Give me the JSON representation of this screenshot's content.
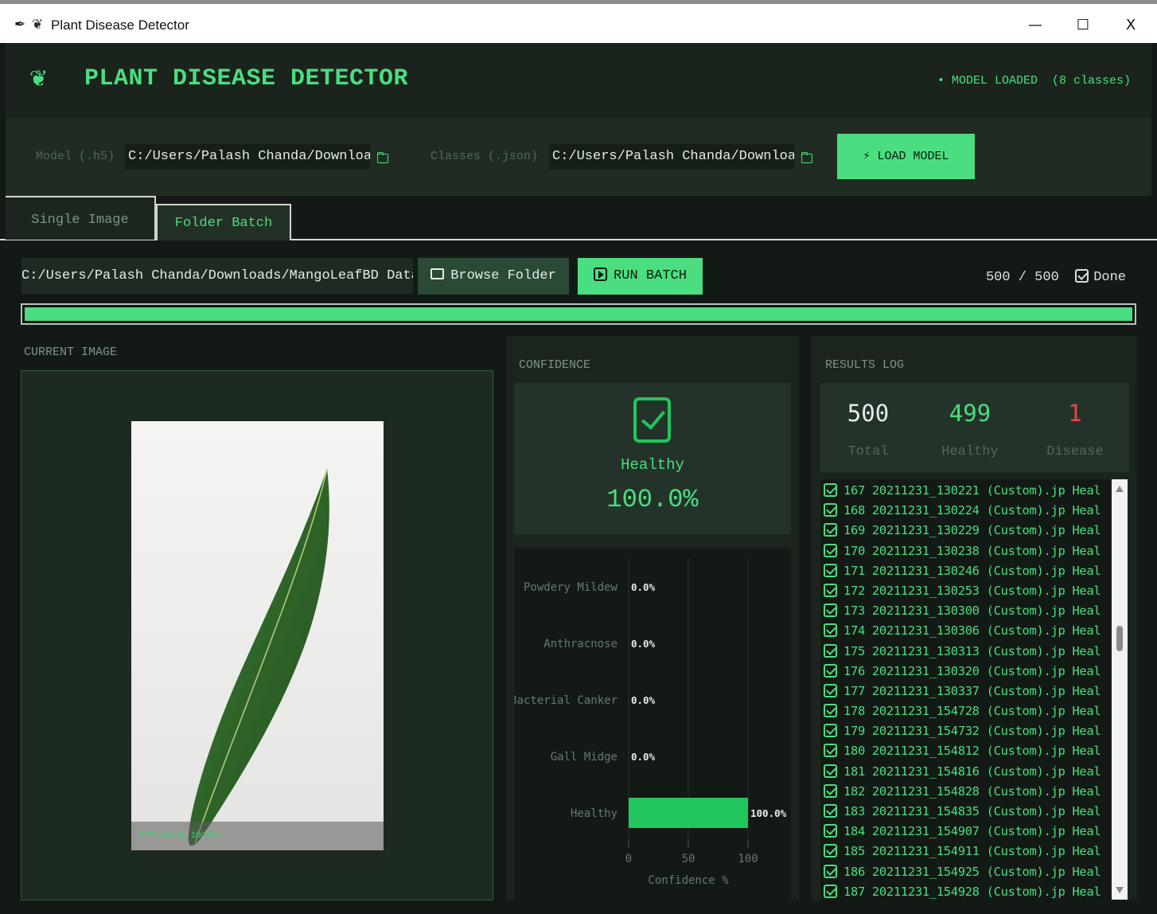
{
  "window": {
    "title": "Plant Disease Detector",
    "feather_icon": "feather-icon",
    "app_icon": "leaf-icon",
    "min_glyph": "—",
    "max_glyph": "☐",
    "close_glyph": "X"
  },
  "header": {
    "logo": "leaf-logo-icon",
    "title": "PLANT DISEASE DETECTOR",
    "status": "• MODEL LOADED  (8 classes)"
  },
  "model": {
    "model_label": "Model (.h5)",
    "model_path": "C:/Users/Palash Chanda/Downloads,",
    "classes_label": "Classes (.json)",
    "classes_path": "C:/Users/Palash Chanda/Downloads,",
    "load_button": "⚡ LOAD MODEL"
  },
  "tabs": [
    {
      "label": "Single Image",
      "active": false
    },
    {
      "label": "Folder Batch",
      "active": true
    }
  ],
  "batch": {
    "folder_path": "C:/Users/Palash Chanda/Downloads/MangoLeafBD Dataset,",
    "browse_label": "Browse Folder",
    "run_label": "RUN BATCH",
    "progress_count": "500 / 500",
    "progress_status": "Done",
    "progress_fraction": 1.0
  },
  "current_image": {
    "title": "CURRENT IMAGE",
    "overlay_text": "??? Healthy  100.0%"
  },
  "confidence": {
    "title": "CONFIDENCE",
    "label": "Healthy",
    "value": "100.0%",
    "status_icon": "check-square-icon"
  },
  "chart_data": {
    "type": "bar",
    "orientation": "horizontal",
    "categories": [
      "Powdery Mildew",
      "Anthracnose",
      "Bacterial Canker",
      "Gall Midge",
      "Healthy"
    ],
    "values": [
      0.0,
      0.0,
      0.0,
      0.0,
      100.0
    ],
    "value_labels": [
      "0.0%",
      "0.0%",
      "0.0%",
      "0.0%",
      "100.0%"
    ],
    "xlabel": "Confidence %",
    "xticks": [
      "0",
      "50",
      "100"
    ],
    "xlim": [
      0,
      100
    ],
    "colors": {
      "bar": "#22c55e",
      "axis": "#4a5a4f"
    }
  },
  "results": {
    "title": "RESULTS LOG",
    "total": "500",
    "total_label": "Total",
    "healthy": "499",
    "healthy_label": "Healthy",
    "disease": "1",
    "disease_label": "Disease",
    "log": [
      "167 20211231_130221 (Custom).jp Heal",
      "168 20211231_130224 (Custom).jp Heal",
      "169 20211231_130229 (Custom).jp Heal",
      "170 20211231_130238 (Custom).jp Heal",
      "171 20211231_130246 (Custom).jp Heal",
      "172 20211231_130253 (Custom).jp Heal",
      "173 20211231_130300 (Custom).jp Heal",
      "174 20211231_130306 (Custom).jp Heal",
      "175 20211231_130313 (Custom).jp Heal",
      "176 20211231_130320 (Custom).jp Heal",
      "177 20211231_130337 (Custom).jp Heal",
      "178 20211231_154728 (Custom).jp Heal",
      "179 20211231_154732 (Custom).jp Heal",
      "180 20211231_154812 (Custom).jp Heal",
      "181 20211231_154816 (Custom).jp Heal",
      "182 20211231_154828 (Custom).jp Heal",
      "183 20211231_154835 (Custom).jp Heal",
      "184 20211231_154907 (Custom).jp Heal",
      "185 20211231_154911 (Custom).jp Heal",
      "186 20211231_154925 (Custom).jp Heal",
      "187 20211231_154928 (Custom).jp Heal"
    ]
  },
  "colors": {
    "accent": "#4ade80",
    "bar": "#22c55e",
    "disease": "#ef4444",
    "background": "#131a15"
  }
}
